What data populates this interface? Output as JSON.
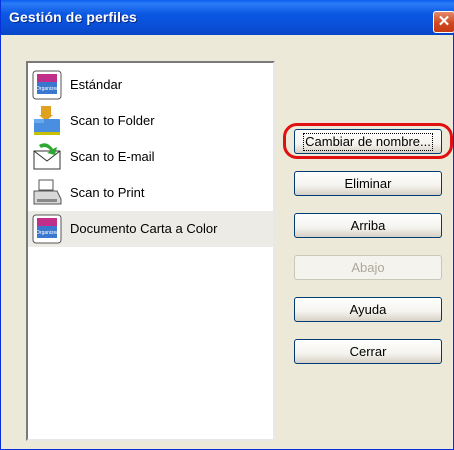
{
  "window": {
    "title": "Gestión de perfiles"
  },
  "profiles": [
    {
      "label": "Estándar",
      "icon": "scansnap-organizer-icon"
    },
    {
      "label": "Scan to Folder",
      "icon": "folder-icon"
    },
    {
      "label": "Scan to E-mail",
      "icon": "email-icon"
    },
    {
      "label": "Scan to Print",
      "icon": "printer-icon"
    },
    {
      "label": "Documento Carta a Color",
      "icon": "scansnap-organizer-icon",
      "selected": true
    }
  ],
  "buttons": {
    "rename": "Cambiar de nombre...",
    "delete": "Eliminar",
    "up": "Arriba",
    "down": "Abajo",
    "help": "Ayuda",
    "close": "Cerrar"
  },
  "colors": {
    "highlight": "#e01010",
    "titlebar": "#0a5ef1",
    "close_button": "#d0491f"
  }
}
